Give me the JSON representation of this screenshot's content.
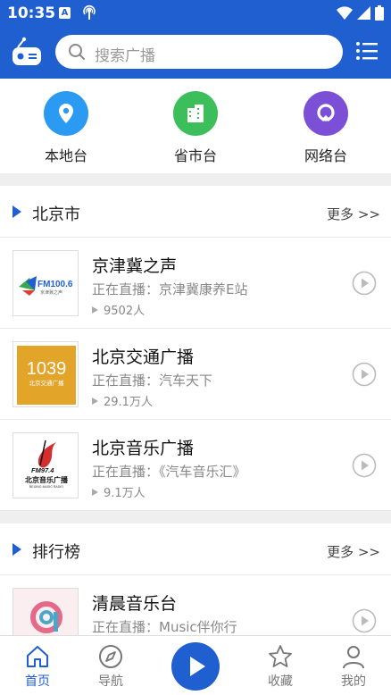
{
  "status_bar": {
    "time": "10:35",
    "notif_letter": "A"
  },
  "search": {
    "placeholder": "搜索广播"
  },
  "categories": [
    {
      "label": "本地台",
      "icon": "location-pin-icon",
      "color": "#2b9af3"
    },
    {
      "label": "省市台",
      "icon": "building-icon",
      "color": "#3cbf5a"
    },
    {
      "label": "网络台",
      "icon": "network-icon",
      "color": "#7b4fd6"
    }
  ],
  "sections": [
    {
      "title": "北京市",
      "more": "更多 >>",
      "items": [
        {
          "name": "京津冀之声",
          "live": "正在直播：京津冀康养E站",
          "listeners": "9502人",
          "logo_text": "FM100.6",
          "logo_sub": "京津冀之声"
        },
        {
          "name": "北京交通广播",
          "live": "正在直播：汽车天下",
          "listeners": "29.1万人",
          "logo_text": "1039",
          "logo_sub": "北京交通广播"
        },
        {
          "name": "北京音乐广播",
          "live": "正在直播：《汽车音乐汇》",
          "listeners": "9.1万人",
          "logo_text": "FM97.4",
          "logo_sub": "北京音乐广播",
          "logo_sub2": "BEIJING MUSIC RADIO"
        }
      ]
    },
    {
      "title": "排行榜",
      "more": "更多 >>",
      "items": [
        {
          "name": "清晨音乐台",
          "live": "正在直播：Music伴你行",
          "listeners": ""
        }
      ]
    }
  ],
  "tabbar": [
    {
      "label": "首页",
      "icon": "home-icon",
      "active": true
    },
    {
      "label": "导航",
      "icon": "compass-icon",
      "active": false
    },
    {
      "label": "收藏",
      "icon": "star-icon",
      "active": false
    },
    {
      "label": "我的",
      "icon": "person-icon",
      "active": false
    }
  ],
  "colors": {
    "brand": "#1f5fd0",
    "background": "#efefef"
  }
}
